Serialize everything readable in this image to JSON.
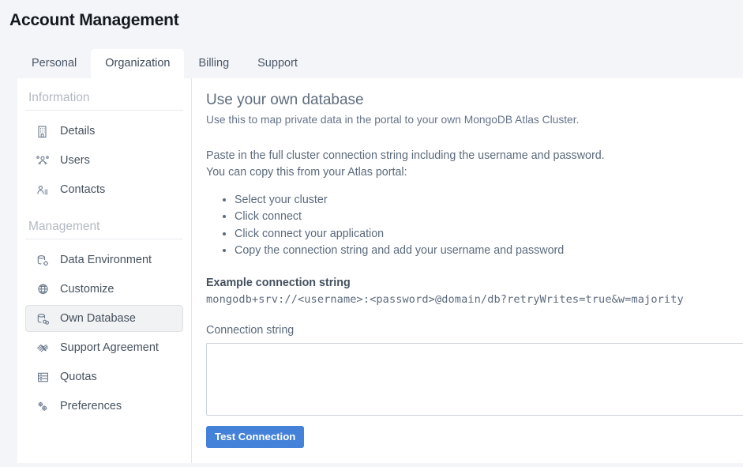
{
  "header": {
    "title": "Account Management"
  },
  "tabs": [
    {
      "label": "Personal",
      "active": false
    },
    {
      "label": "Organization",
      "active": true
    },
    {
      "label": "Billing",
      "active": false
    },
    {
      "label": "Support",
      "active": false
    }
  ],
  "sidebar": {
    "sections": [
      {
        "title": "Information",
        "items": [
          {
            "label": "Details",
            "icon": "building-icon",
            "selected": false
          },
          {
            "label": "Users",
            "icon": "users-group-icon",
            "selected": false
          },
          {
            "label": "Contacts",
            "icon": "contact-card-icon",
            "selected": false
          }
        ]
      },
      {
        "title": "Management",
        "items": [
          {
            "label": "Data Environment",
            "icon": "database-gear-icon",
            "selected": false
          },
          {
            "label": "Customize",
            "icon": "globe-icon",
            "selected": false
          },
          {
            "label": "Own Database",
            "icon": "database-link-icon",
            "selected": true
          },
          {
            "label": "Support Agreement",
            "icon": "handshake-icon",
            "selected": false
          },
          {
            "label": "Quotas",
            "icon": "server-stack-icon",
            "selected": false
          },
          {
            "label": "Preferences",
            "icon": "gears-icon",
            "selected": false
          }
        ]
      }
    ]
  },
  "main": {
    "title": "Use your own database",
    "subtitle": "Use this to map private data in the portal to your own MongoDB Atlas Cluster.",
    "paragraph_line1": "Paste in the full cluster connection string including the username and password.",
    "paragraph_line2": "You can copy this from your Atlas portal:",
    "steps": [
      "Select your cluster",
      "Click connect",
      "Click connect your application",
      "Copy the connection string and add your username and password"
    ],
    "example_label": "Example connection string",
    "example_string": "mongodb+srv://<username>:<password>@domain/db?retryWrites=true&w=majority",
    "field_label": "Connection string",
    "connection_value": "",
    "connection_placeholder": "",
    "test_button": "Test Connection"
  },
  "colors": {
    "page_background": "#f4f5f9",
    "panel_background": "#ffffff",
    "primary_button": "#4481d8",
    "selected_item_background": "#f1f2f3",
    "text_muted": "#5b6a7c"
  }
}
